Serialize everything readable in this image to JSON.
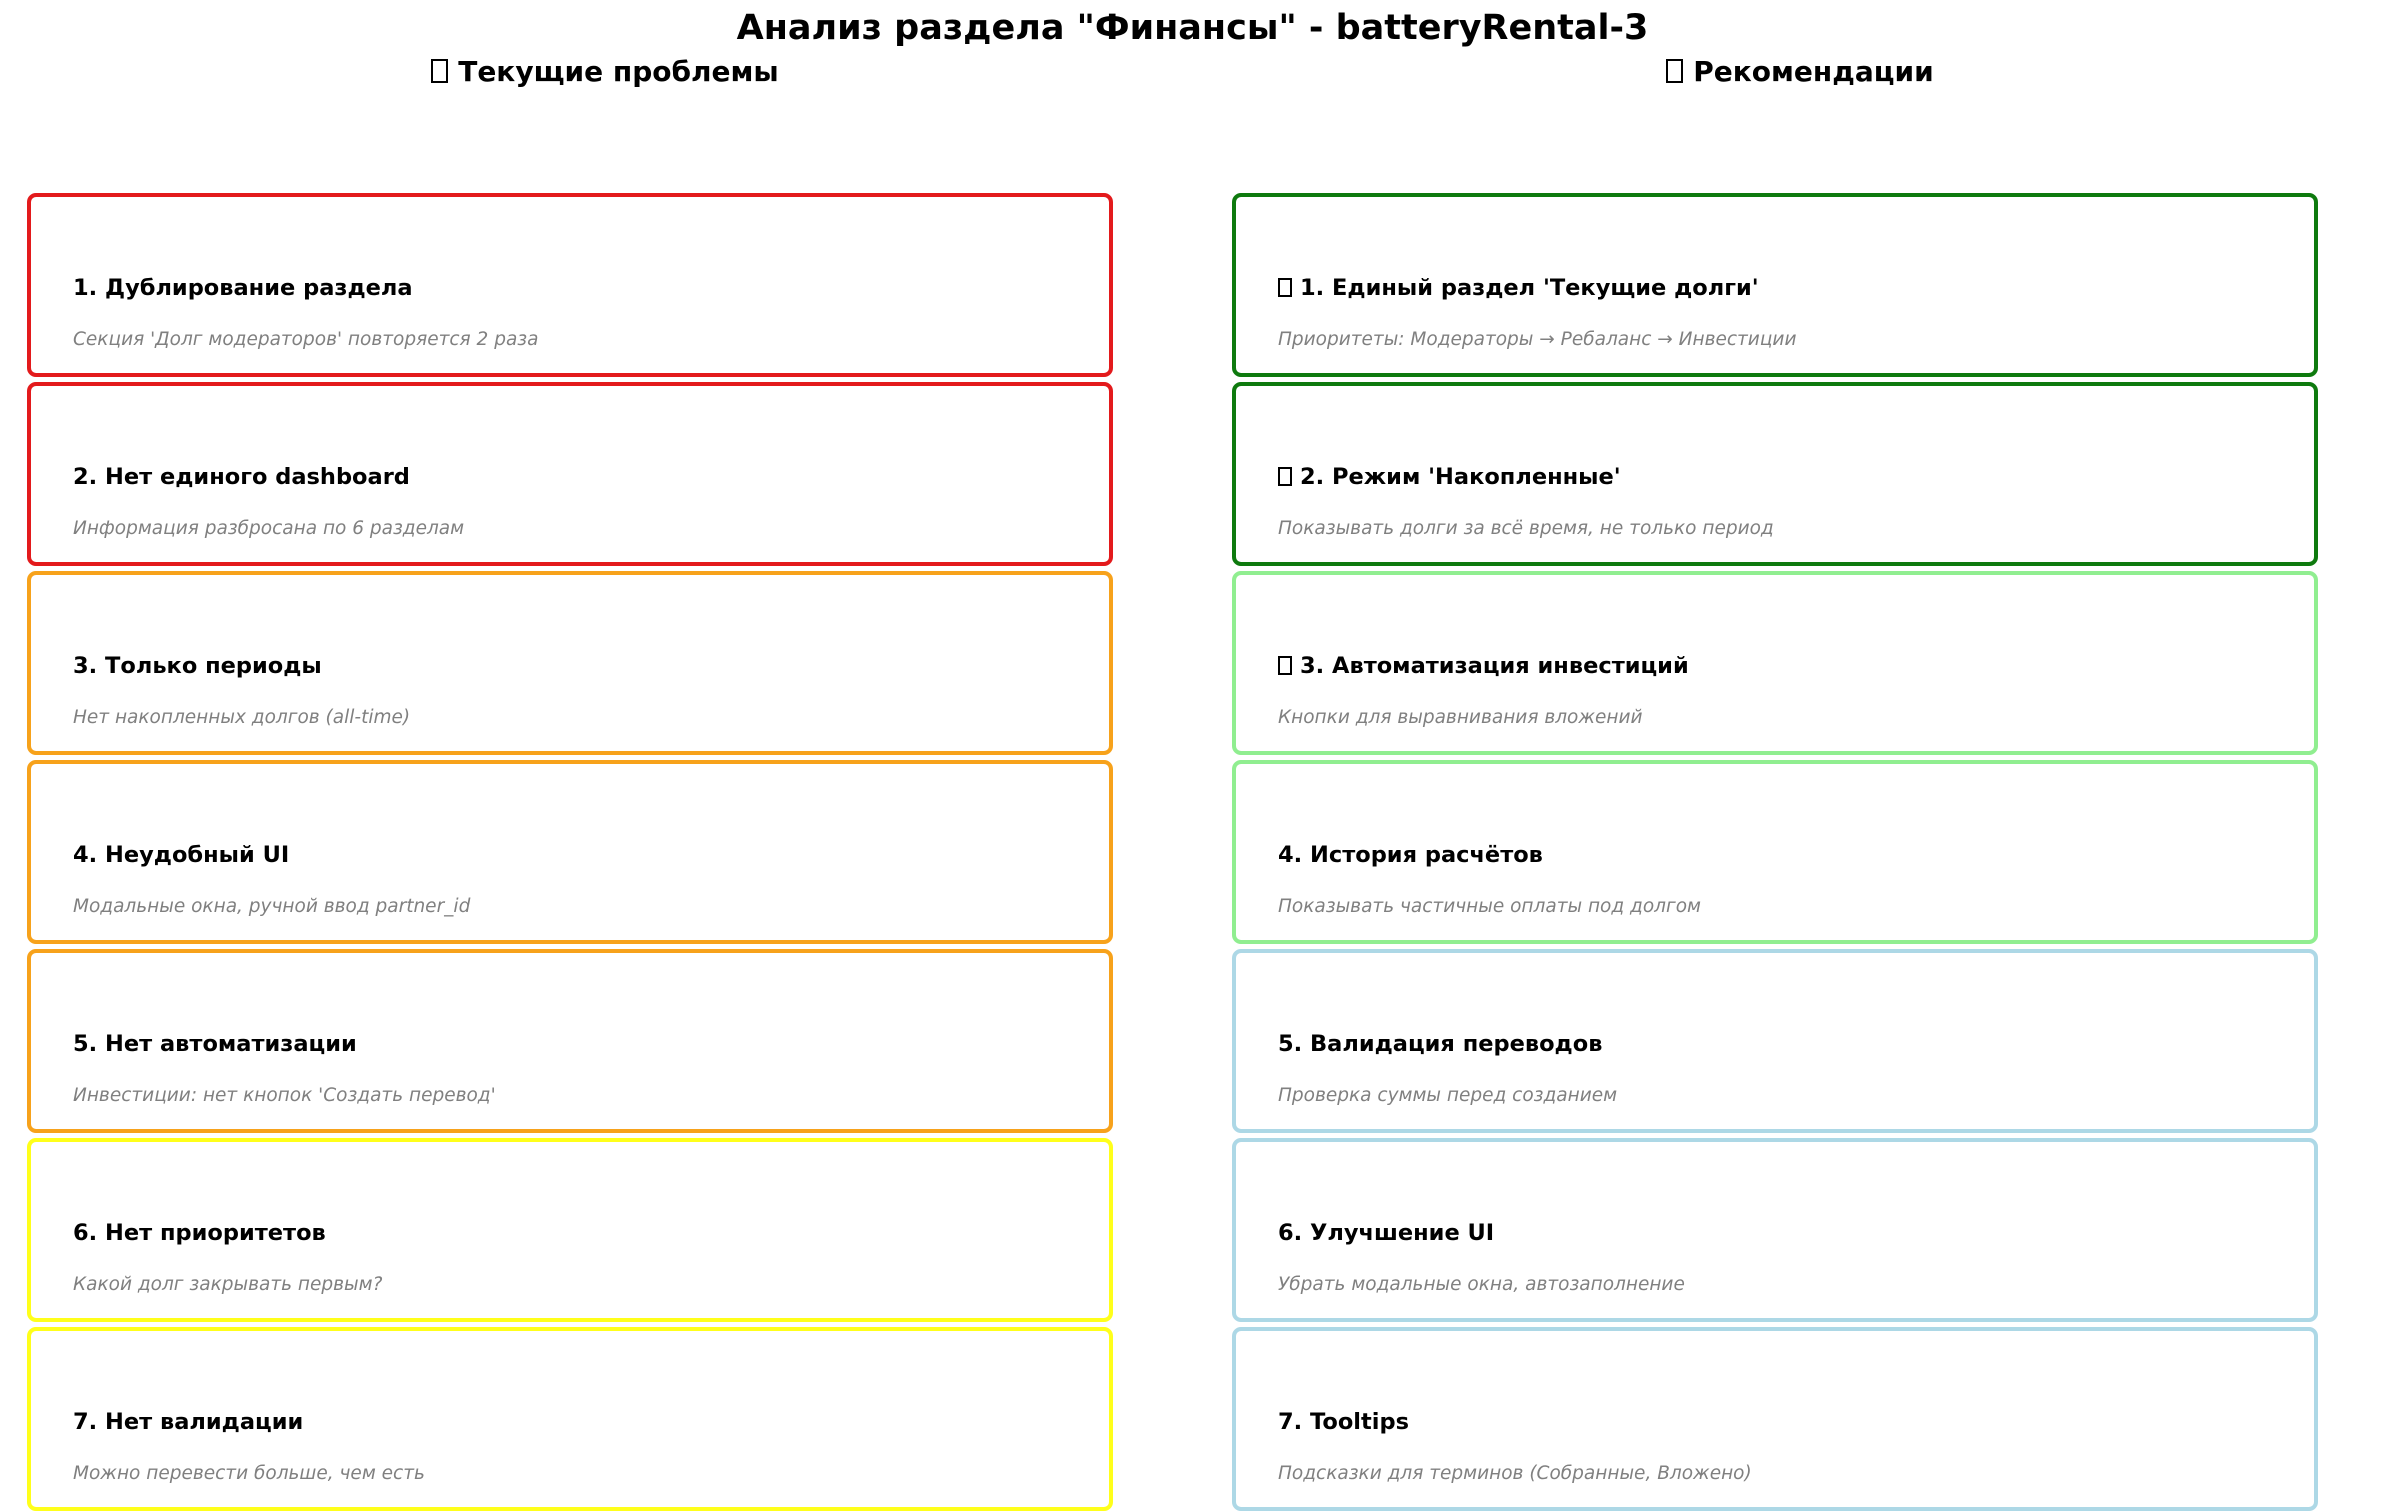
{
  "title": "Анализ раздела \"Финансы\" - batteryRental-3",
  "problems": {
    "header": "Текущие проблемы",
    "header_icon": "unrendered-glyph-box",
    "items": [
      {
        "title": "1. Дублирование раздела",
        "desc": "Секция 'Долг модераторов' повторяется 2 раза",
        "color": "#e31a1c"
      },
      {
        "title": "2. Нет единого dashboard",
        "desc": "Информация разбросана по 6 разделам",
        "color": "#e31a1c"
      },
      {
        "title": "3. Только периоды",
        "desc": "Нет накопленных долгов (all-time)",
        "color": "#f7a21b"
      },
      {
        "title": "4. Неудобный UI",
        "desc": "Модальные окна, ручной ввод partner_id",
        "color": "#f7a21b"
      },
      {
        "title": "5. Нет автоматизации",
        "desc": "Инвестиции: нет кнопок 'Создать перевод'",
        "color": "#f7a21b"
      },
      {
        "title": "6. Нет приоритетов",
        "desc": "Какой долг закрывать первым?",
        "color": "#ffff1a"
      },
      {
        "title": "7. Нет валидации",
        "desc": "Можно перевести больше, чем есть",
        "color": "#ffff1a"
      }
    ]
  },
  "recommendations": {
    "header": "Рекомендации",
    "header_icon": "unrendered-glyph-box",
    "items": [
      {
        "title": "1. Единый раздел 'Текущие долги'",
        "desc": "Приоритеты: Модераторы → Ребаланс → Инвестиции",
        "color": "#0e7a0e",
        "icon": "unrendered-glyph-box"
      },
      {
        "title": "2. Режим 'Накопленные'",
        "desc": "Показывать долги за всё время, не только период",
        "color": "#0e7a0e",
        "icon": "unrendered-glyph-box"
      },
      {
        "title": "3. Автоматизация инвестиций",
        "desc": "Кнопки для выравнивания вложений",
        "color": "#90ee90",
        "icon": "unrendered-glyph-box"
      },
      {
        "title": "4. История расчётов",
        "desc": "Показывать частичные оплаты под долгом",
        "color": "#90ee90"
      },
      {
        "title": "5. Валидация переводов",
        "desc": "Проверка суммы перед созданием",
        "color": "#add8e6"
      },
      {
        "title": "6. Улучшение UI",
        "desc": "Убрать модальные окна, автозаполнение",
        "color": "#add8e6"
      },
      {
        "title": "7. Tooltips",
        "desc": "Подсказки для терминов (Собранные, Вложено)",
        "color": "#add8e6"
      }
    ]
  }
}
